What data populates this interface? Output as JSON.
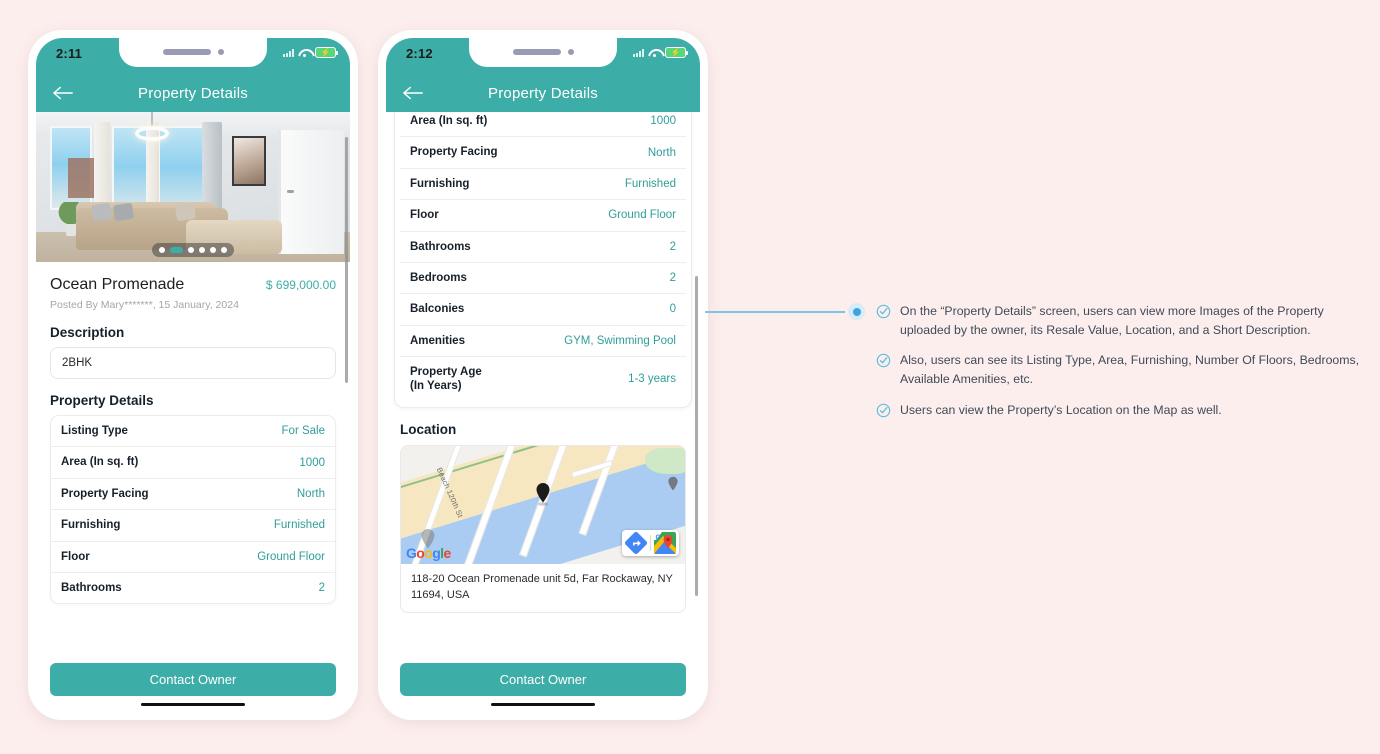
{
  "background_color": "#FDEEEE",
  "accent_color": "#3DADA8",
  "annotation_color": "#3AA6DD",
  "phones": [
    {
      "id": "phone-one",
      "status_bar": {
        "time": "2:11",
        "wifi_icon": "wifi-icon",
        "battery_icon": "battery-charging-icon",
        "signal_icon": "signal-icon"
      },
      "appbar": {
        "title": "Property Details",
        "back_icon": "back-arrow-icon"
      },
      "carousel": {
        "total_dots": 6,
        "active_index": 1,
        "image_alt": "living-room-photo"
      },
      "listing": {
        "title": "Ocean Promenade",
        "price": "$ 699,000.00",
        "posted": "Posted By Mary*******, 15 January, 2024"
      },
      "description": {
        "heading": "Description",
        "value": "2BHK"
      },
      "details": {
        "heading": "Property Details",
        "rows": [
          {
            "label": "Listing Type",
            "value": "For Sale"
          },
          {
            "label": "Area (In sq. ft)",
            "value": "1000"
          },
          {
            "label": "Property Facing",
            "value": "North"
          },
          {
            "label": "Furnishing",
            "value": "Furnished"
          },
          {
            "label": "Floor",
            "value": "Ground Floor"
          },
          {
            "label": "Bathrooms",
            "value": "2"
          }
        ]
      },
      "cta_label": "Contact Owner"
    },
    {
      "id": "phone-two",
      "status_bar": {
        "time": "2:12",
        "wifi_icon": "wifi-icon",
        "battery_icon": "battery-charging-icon",
        "signal_icon": "signal-icon"
      },
      "appbar": {
        "title": "Property Details",
        "back_icon": "back-arrow-icon"
      },
      "details": {
        "clipped_row": {
          "label": "Area (In sq. ft)",
          "value": "1000"
        },
        "rows": [
          {
            "label": "Property Facing",
            "value": "North"
          },
          {
            "label": "Furnishing",
            "value": "Furnished"
          },
          {
            "label": "Floor",
            "value": "Ground Floor"
          },
          {
            "label": "Bathrooms",
            "value": "2"
          },
          {
            "label": "Bedrooms",
            "value": "2"
          },
          {
            "label": "Balconies",
            "value": "0"
          },
          {
            "label": "Amenities",
            "value": "GYM, Swimming Pool"
          },
          {
            "label": "Property Age\n(In Years)",
            "value": "1-3 years"
          }
        ]
      },
      "location": {
        "heading": "Location",
        "map": {
          "street_label": "Beach 120th St",
          "brand": "Google",
          "pin_icon": "map-pin-icon",
          "directions_icon": "directions-icon",
          "open-maps-icon": "google-maps-icon"
        },
        "address": "118-20 Ocean Promenade unit 5d, Far Rockaway, NY 11694, USA"
      },
      "cta_label": "Contact Owner"
    }
  ],
  "annotations": [
    {
      "icon": "check-circle-icon",
      "text": "On the “Property Details” screen, users can view more Images of the Property uploaded by the owner, its Resale Value, Location, and a Short Description."
    },
    {
      "icon": "check-circle-icon",
      "text": "Also, users can see its Listing Type, Area, Furnishing, Number Of Floors, Bedrooms, Available Amenities, etc."
    },
    {
      "icon": "check-circle-icon",
      "text": "Users can view the Property’s Location on the Map as well."
    }
  ]
}
